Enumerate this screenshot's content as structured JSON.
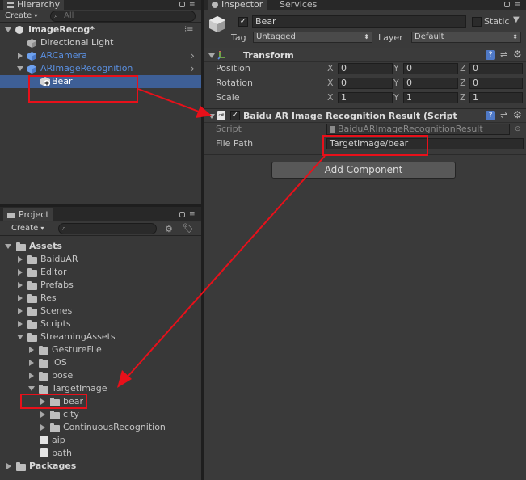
{
  "hierarchy": {
    "tab_label": "Hierarchy",
    "create_label": "Create",
    "search_placeholder": "All",
    "scene_name": "ImageRecog*",
    "items": [
      {
        "label": "Directional Light"
      },
      {
        "label": "ARCamera"
      },
      {
        "label": "ARImageRecognition"
      },
      {
        "label": "Bear"
      }
    ]
  },
  "project": {
    "tab_label": "Project",
    "create_label": "Create",
    "items": [
      {
        "label": "Assets"
      },
      {
        "label": "BaiduAR"
      },
      {
        "label": "Editor"
      },
      {
        "label": "Prefabs"
      },
      {
        "label": "Res"
      },
      {
        "label": "Scenes"
      },
      {
        "label": "Scripts"
      },
      {
        "label": "StreamingAssets"
      },
      {
        "label": "GestureFile"
      },
      {
        "label": "iOS"
      },
      {
        "label": "pose"
      },
      {
        "label": "TargetImage"
      },
      {
        "label": "bear"
      },
      {
        "label": "city"
      },
      {
        "label": "ContinuousRecognition"
      },
      {
        "label": "aip"
      },
      {
        "label": "path"
      },
      {
        "label": "Packages"
      }
    ]
  },
  "inspector": {
    "tab_label": "Inspector",
    "services_tab": "Services",
    "object_name": "Bear",
    "static_label": "Static",
    "tag_label": "Tag",
    "tag_value": "Untagged",
    "layer_label": "Layer",
    "layer_value": "Default",
    "transform": {
      "title": "Transform",
      "position_label": "Position",
      "rotation_label": "Rotation",
      "scale_label": "Scale",
      "axis_x": "X",
      "axis_y": "Y",
      "axis_z": "Z",
      "position": [
        "0",
        "0",
        "0"
      ],
      "rotation": [
        "0",
        "0",
        "0"
      ],
      "scale": [
        "1",
        "1",
        "1"
      ]
    },
    "component": {
      "title": "Baidu AR Image Recognition Result (Script",
      "script_label": "Script",
      "script_value": "BaiduARImageRecognitionResult",
      "file_path_label": "File Path",
      "file_path_value": "TargetImage/bear"
    },
    "add_component_label": "Add Component"
  },
  "colors": {
    "selection": "#3e5f96",
    "annotation": "#e8101a",
    "link_blue": "#5a8fe0"
  }
}
